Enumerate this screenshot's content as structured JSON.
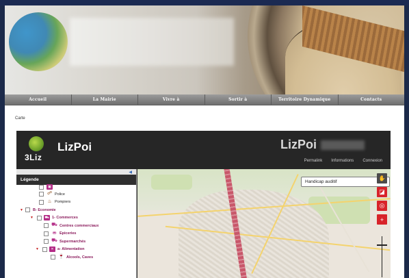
{
  "nav": {
    "items": [
      "Accueil",
      "La Mairie",
      "Vivre à",
      "Sortir à",
      "Territoire Dynamique",
      "Contacts"
    ]
  },
  "page": {
    "section_label": "Carte"
  },
  "app": {
    "logo_text": "3Liz",
    "title": "LizPoi",
    "brand": "LizPoi",
    "links": [
      "Permalink",
      "Informations",
      "Connexion"
    ]
  },
  "legend": {
    "title": "Légende",
    "items": [
      {
        "label": "Police",
        "level": 2,
        "icon": "police-icon"
      },
      {
        "label": "Pompiers",
        "level": 2,
        "icon": "fire-icon"
      },
      {
        "label": "B- Economie",
        "level": 0,
        "icon": "none"
      },
      {
        "label": "1- Commerces",
        "level": 1,
        "icon": "cart-icon"
      },
      {
        "label": "Centres commerciaux",
        "level": 2,
        "icon": "cart-icon"
      },
      {
        "label": "Epiceries",
        "level": 2,
        "icon": "basket-icon"
      },
      {
        "label": "Supermarchés",
        "level": 2,
        "icon": "cart-icon"
      },
      {
        "label": "a- Alimentation",
        "level": 1,
        "icon": "food-icon"
      },
      {
        "label": "Alcools, Caves",
        "level": 2,
        "icon": "bottle-icon"
      }
    ]
  },
  "map": {
    "select_value": "Handicap auditif"
  },
  "colors": {
    "accent_red": "#d8232a",
    "header_dark": "#262626",
    "legend_bold": "#8b1b5c"
  }
}
